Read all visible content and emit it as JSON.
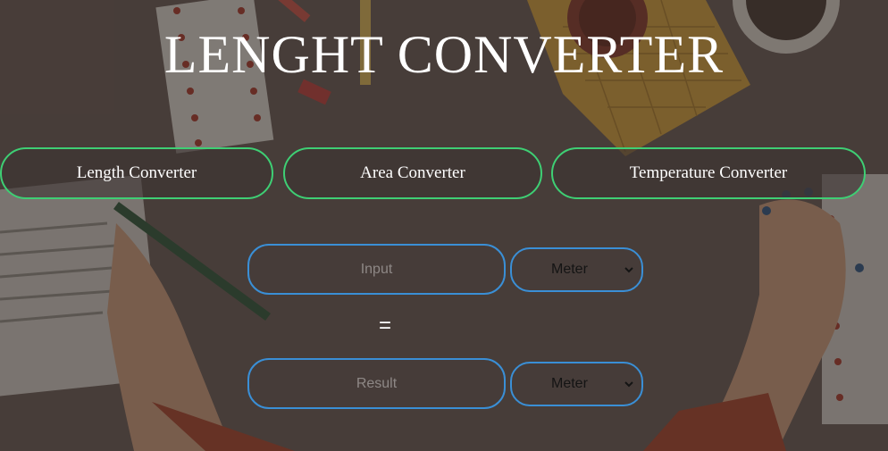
{
  "page": {
    "title": "LENGHT CONVERTER"
  },
  "tabs": [
    {
      "label": "Length Converter"
    },
    {
      "label": "Area Converter"
    },
    {
      "label": "Temperature Converter"
    }
  ],
  "converter": {
    "input": {
      "value": "",
      "placeholder": "Input"
    },
    "input_unit": {
      "selected": "Meter"
    },
    "equals_sign": "=",
    "result": {
      "value": "",
      "placeholder": "Result"
    },
    "result_unit": {
      "selected": "Meter"
    }
  },
  "colors": {
    "tab_border": "#3ecf74",
    "field_border": "#3a8fd6",
    "background": "#3d3533"
  }
}
